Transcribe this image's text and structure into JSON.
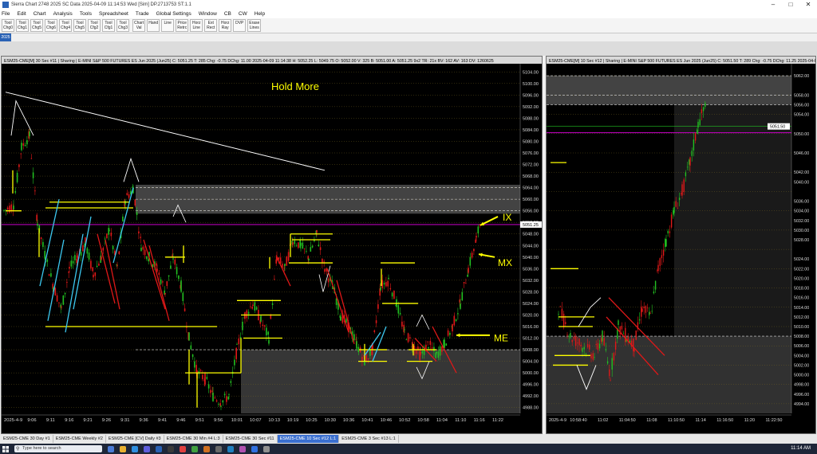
{
  "titlebar": {
    "text": "Sierra Chart 2748 2025 SC Data 2025-04-09 11:14:53 Wed [Sim] DP.2713753  ST:1.1"
  },
  "menu": [
    "File",
    "Edit",
    "Chart",
    "Analysis",
    "Tools",
    "Spreadsheet",
    "Trade",
    "Global Settings",
    "Window",
    "CB",
    "CW",
    "Help"
  ],
  "toolbar": [
    {
      "label": "Tool\nChg0"
    },
    {
      "label": "Tool\nChg1"
    },
    {
      "label": "Tool\nChg5"
    },
    {
      "label": "Tool\nChg6"
    },
    {
      "label": "Tool\nChg4"
    },
    {
      "label": "Tool\nChg5"
    },
    {
      "label": "Tool\nCfg2"
    },
    {
      "label": "Tool\nCfg1"
    },
    {
      "label": "Tool\nChg3"
    },
    {
      "label": "Chart\nVal"
    },
    {
      "label": "Hand"
    },
    {
      "label": "Line"
    },
    {
      "label": "Price\nRetrc"
    },
    {
      "label": "Horz\nLine"
    },
    {
      "label": "Ext\nRect"
    },
    {
      "label": "Horz\nRay"
    },
    {
      "label": "DVP"
    },
    {
      "label": "Erase\nLines"
    }
  ],
  "year_tag": "2025",
  "left_chart": {
    "header": "ESM25-CME[M]  30 Sec  #11 | Sharing | E-MINI S&P 500 FUTURES ES Jun 2025 (Jun25)  C: 5051.25  T: 285  Chg: -0.75  DChg: 11.00  2025-04-09 11:14:38  H: 5052.25  L: 5049.75  O: 5052.00  V: 325  B: 5051.00  A: 5051.25  9x2  TR: 21x  BV: 162  AV: 163  DV: 1260625",
    "annotation": "Hold More",
    "price_label": "5051.25",
    "price_axis": [
      "5104.00",
      "5100.00",
      "5096.00",
      "5092.00",
      "5088.00",
      "5084.00",
      "5080.00",
      "5076.00",
      "5072.00",
      "5068.00",
      "5064.00",
      "5060.00",
      "5056.00",
      "5052.00",
      "5048.00",
      "5044.00",
      "5040.00",
      "5036.00",
      "5032.00",
      "5028.00",
      "5024.00",
      "5020.00",
      "5016.00",
      "5012.00",
      "5008.00",
      "5004.00",
      "5000.00",
      "4996.00",
      "4992.00",
      "4988.00"
    ],
    "time_axis": [
      "2025-4-9",
      "9:06",
      "9:11",
      "9:16",
      "9:21",
      "9:26",
      "9:31",
      "9:36",
      "9:41",
      "9:46",
      "9:51",
      "9:56",
      "10:01",
      "10:07",
      "10:13",
      "10:19",
      "10:25",
      "10:30",
      "10:36",
      "10:41",
      "10:46",
      "10:52",
      "10:58",
      "11:04",
      "11:10",
      "11:16",
      "11:22"
    ],
    "labels": {
      "ix": "IX",
      "mx": "MX",
      "me": "ME"
    }
  },
  "right_chart": {
    "header": "ESM25-CME[M]  10 Sec  #12 | Sharing | E-MINI S&P 500 FUTURES ES Jun 2025 (Jun25)  C: 5051.50  T: 289  Chg: -0.75  DChg: 11.25  2025-04-09 11:14:38 H: 5052.25",
    "price_label": "5051.50",
    "price_axis": [
      "5062.00",
      "5058.00",
      "5056.00",
      "5054.00",
      "5050.00",
      "5046.00",
      "5042.00",
      "5040.00",
      "5036.00",
      "5034.00",
      "5032.00",
      "5030.00",
      "5028.00",
      "5024.00",
      "5022.00",
      "5020.00",
      "5018.00",
      "5016.00",
      "5014.00",
      "5012.00",
      "5010.00",
      "5008.00",
      "5006.00",
      "5004.00",
      "5002.00",
      "5000.00",
      "4998.00",
      "4996.00",
      "4994.00"
    ],
    "time_axis": [
      "2025-4-9",
      "10:58:40",
      "11:02",
      "11:04:50",
      "11:08",
      "11:10:50",
      "11:14",
      "11:16:50",
      "11:20",
      "11:22:50"
    ]
  },
  "tabs": [
    {
      "label": "ESM25-CME 30 Day #1",
      "active": false
    },
    {
      "label": "ESM25-CME Weekly #2",
      "active": false
    },
    {
      "label": "ESM25-CME [CV] Daily #3",
      "active": false
    },
    {
      "label": "ESM25-CME 30 Min #4 L:3",
      "active": false
    },
    {
      "label": "ESM25-CME 30 Sec #11",
      "active": false
    },
    {
      "label": "ESM25-CME 10 Sec #12 L:1",
      "active": true
    },
    {
      "label": "ESM25-CME 3 Sec #13 L:1",
      "active": false
    }
  ],
  "taskbar": {
    "search_placeholder": "Type here to search",
    "clock": "11:14 AM"
  },
  "colors": {
    "up": "#22c021",
    "down": "#e01818",
    "purple": "#b400b4",
    "yellow": "#ffff00",
    "cyan": "#3cc8f0"
  }
}
